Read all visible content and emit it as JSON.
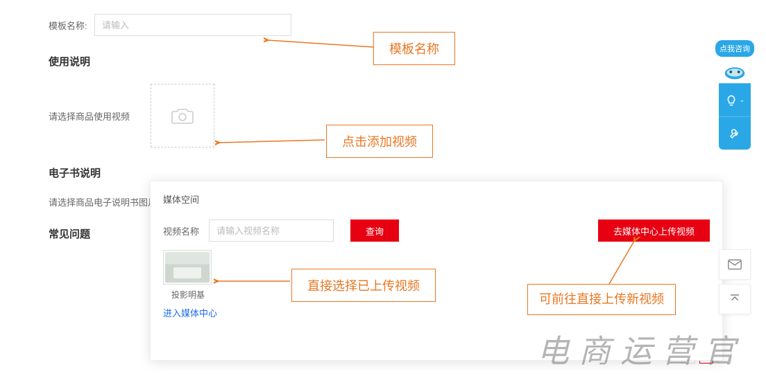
{
  "form": {
    "templateName": {
      "label": "模板名称:",
      "placeholder": "请输入",
      "value": ""
    }
  },
  "sections": {
    "usage": {
      "title": "使用说明",
      "videoLabel": "请选择商品使用视频"
    },
    "ebook": {
      "title": "电子书说明",
      "imageLabel": "请选择商品电子说明书图片"
    },
    "faq": {
      "title": "常见问题"
    }
  },
  "annotations": {
    "templateName": "模板名称",
    "addVideo": "点击添加视频",
    "selectUploaded": "直接选择已上传视频",
    "gotoUpload": "可前往直接上传新视频"
  },
  "modal": {
    "title": "媒体空间",
    "searchLabel": "视频名称",
    "searchPlaceholder": "请输入视频名称",
    "queryBtn": "查询",
    "uploadBtn": "去媒体中心上传视频",
    "items": [
      {
        "caption": "投影明基"
      }
    ],
    "link": "进入媒体中心"
  },
  "float": {
    "consult": "点我咨询"
  },
  "watermark": "电商运营官"
}
